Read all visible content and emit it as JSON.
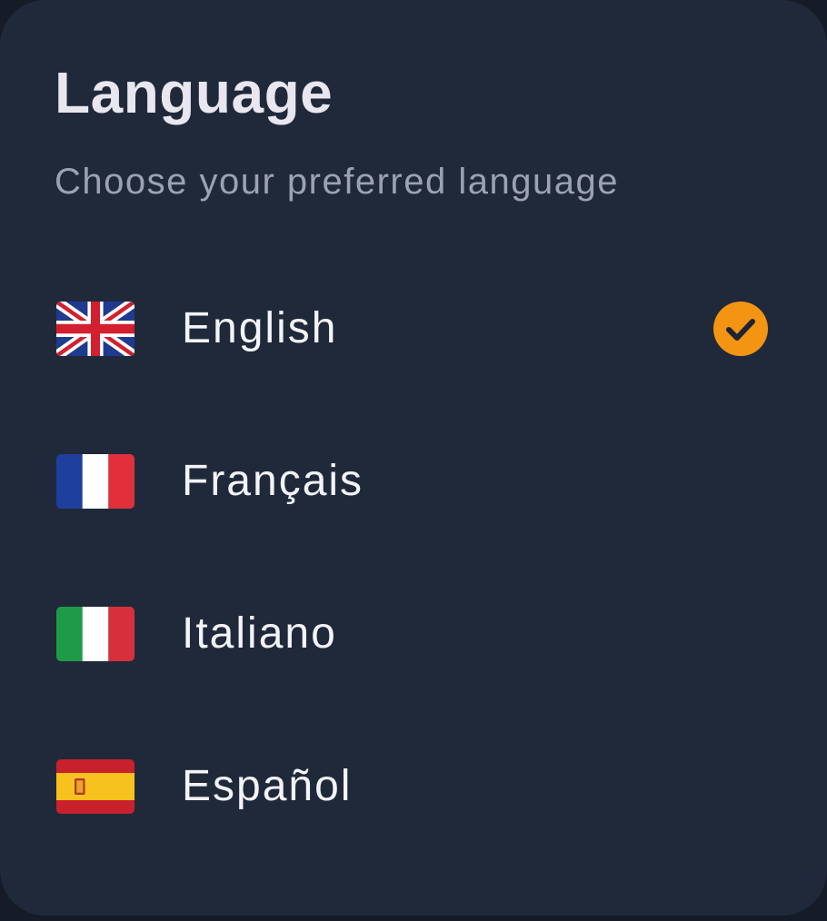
{
  "header": {
    "title": "Language",
    "subtitle": "Choose your preferred language"
  },
  "languages": [
    {
      "label": "English",
      "flag_icon": "uk-flag-icon",
      "selected": true
    },
    {
      "label": "Français",
      "flag_icon": "france-flag-icon",
      "selected": false
    },
    {
      "label": "Italiano",
      "flag_icon": "italy-flag-icon",
      "selected": false
    },
    {
      "label": "Español",
      "flag_icon": "spain-flag-icon",
      "selected": false
    }
  ],
  "colors": {
    "background": "#20293a",
    "accent": "#f39512",
    "text_primary": "#f3f4f7",
    "text_secondary": "#9aa2b4"
  },
  "selected_icon": "checkmark-circle-icon"
}
